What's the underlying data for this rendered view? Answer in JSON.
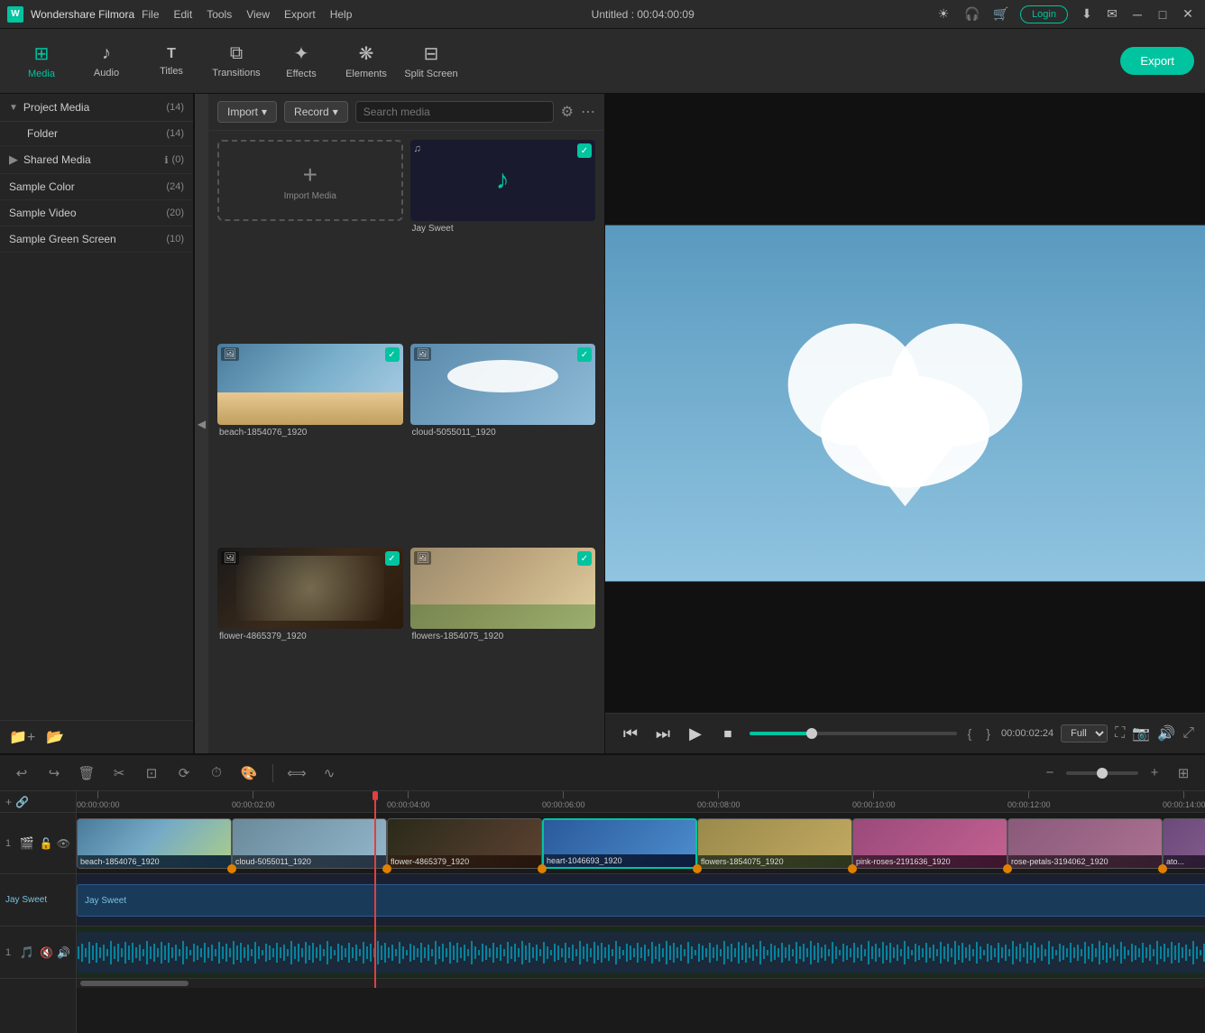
{
  "app": {
    "name": "Wondershare Filmora",
    "title": "Untitled : 00:04:00:09",
    "logo_letter": "W"
  },
  "titlebar": {
    "menus": [
      "File",
      "Edit",
      "Tools",
      "View",
      "Export",
      "Help"
    ],
    "login_label": "Login",
    "window_controls": [
      "─",
      "□",
      "✕"
    ]
  },
  "toolbar": {
    "items": [
      {
        "id": "media",
        "icon": "⊞",
        "label": "Media"
      },
      {
        "id": "audio",
        "icon": "♪",
        "label": "Audio"
      },
      {
        "id": "titles",
        "icon": "T",
        "label": "Titles"
      },
      {
        "id": "transitions",
        "icon": "⧉",
        "label": "Transitions"
      },
      {
        "id": "effects",
        "icon": "✦",
        "label": "Effects"
      },
      {
        "id": "elements",
        "icon": "❋",
        "label": "Elements"
      },
      {
        "id": "splitscreen",
        "icon": "⊟",
        "label": "Split Screen"
      }
    ],
    "active_item": "media",
    "export_label": "Export"
  },
  "left_panel": {
    "project_media": {
      "label": "Project Media",
      "count": "14"
    },
    "folder": {
      "label": "Folder",
      "count": "14"
    },
    "shared_media": {
      "label": "Shared Media",
      "count": "0",
      "has_info": true
    },
    "sample_color": {
      "label": "Sample Color",
      "count": "24"
    },
    "sample_video": {
      "label": "Sample Video",
      "count": "20"
    },
    "sample_green_screen": {
      "label": "Sample Green Screen",
      "count": "10"
    }
  },
  "media_panel": {
    "import_label": "Import",
    "record_label": "Record",
    "search_placeholder": "Search media",
    "items": [
      {
        "id": "import_placeholder",
        "type": "import",
        "label": "Import Media"
      },
      {
        "id": "jay_sweet",
        "type": "audio",
        "label": "Jay Sweet",
        "checked": true
      },
      {
        "id": "beach",
        "type": "image",
        "label": "beach-1854076_1920",
        "checked": true,
        "color": "#4a7a9b"
      },
      {
        "id": "cloud",
        "type": "image",
        "label": "cloud-5055011_1920",
        "checked": true,
        "color": "#6a8aab"
      },
      {
        "id": "flower",
        "type": "image",
        "label": "flower-4865379_1920",
        "checked": true,
        "color": "#3a2a1b"
      },
      {
        "id": "flowers",
        "type": "image",
        "label": "flowers-1854075_1920",
        "checked": true,
        "color": "#7a8a5b"
      }
    ]
  },
  "preview": {
    "current_time": "00:00:02:24",
    "progress": 30,
    "quality": "Full",
    "playback_controls": [
      "⏮",
      "⏭",
      "▶",
      "⏹"
    ]
  },
  "timeline": {
    "ruler_marks": [
      "00:00:00:00",
      "00:00:02:00",
      "00:00:04:00",
      "00:00:06:00",
      "00:00:08:00",
      "00:00:10:00",
      "00:00:12:00",
      "00:00:14:00"
    ],
    "tracks": [
      {
        "id": "v1",
        "type": "video",
        "num": "1",
        "clips": [
          {
            "id": "beach-clip",
            "label": "beach-1854076_1920",
            "color_start": "#4a7a9b",
            "color_end": "#2a5a7b"
          },
          {
            "id": "cloud-clip",
            "label": "cloud-5055011_1920",
            "color_start": "#6a8a9b",
            "color_end": "#4a6a8b"
          },
          {
            "id": "flower-clip",
            "label": "flower-4865379_1920",
            "color_start": "#6a4a2b",
            "color_end": "#4a2a1b"
          },
          {
            "id": "heart-clip",
            "label": "heart-1046693_1920",
            "color_start": "#2a5a9b",
            "color_end": "#1a3a7b",
            "active": true
          },
          {
            "id": "flowers2-clip",
            "label": "flowers-1854075_1920",
            "color_start": "#7a8a4b",
            "color_end": "#5a6a3b"
          },
          {
            "id": "roses-clip",
            "label": "pink-roses-2191636_1920",
            "color_start": "#9a4a7b",
            "color_end": "#7a2a5b"
          },
          {
            "id": "rose2-clip",
            "label": "rose-petals-3194062_1920",
            "color_start": "#8a5a7b",
            "color_end": "#6a3a5b"
          }
        ]
      },
      {
        "id": "a1",
        "type": "audio",
        "num": "1",
        "label": "Jay Sweet"
      }
    ]
  },
  "colors": {
    "accent": "#00c4a0",
    "bg_dark": "#1a1a1a",
    "bg_panel": "#252525",
    "bg_media": "#2a2a2a",
    "active_clip_border": "#00c4a0",
    "playhead": "#e04040"
  }
}
